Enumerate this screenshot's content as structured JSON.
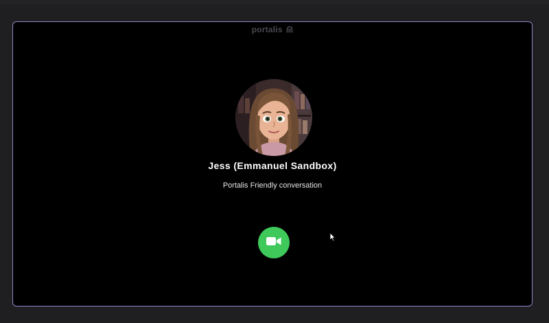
{
  "brand": {
    "name": "portalis",
    "icon": "portalis-arch-icon"
  },
  "agent": {
    "name": "Jess (Emmanuel Sandbox)",
    "description": "Portalis Friendly conversation",
    "avatar": "cartoon-avatar-portrait"
  },
  "controls": {
    "start_call_icon": "video-camera-icon",
    "start_call_color": "#3ec95a"
  },
  "colors": {
    "frame_border": "#8f86c9",
    "frame_background": "#000000",
    "page_background": "#1f1f21"
  }
}
